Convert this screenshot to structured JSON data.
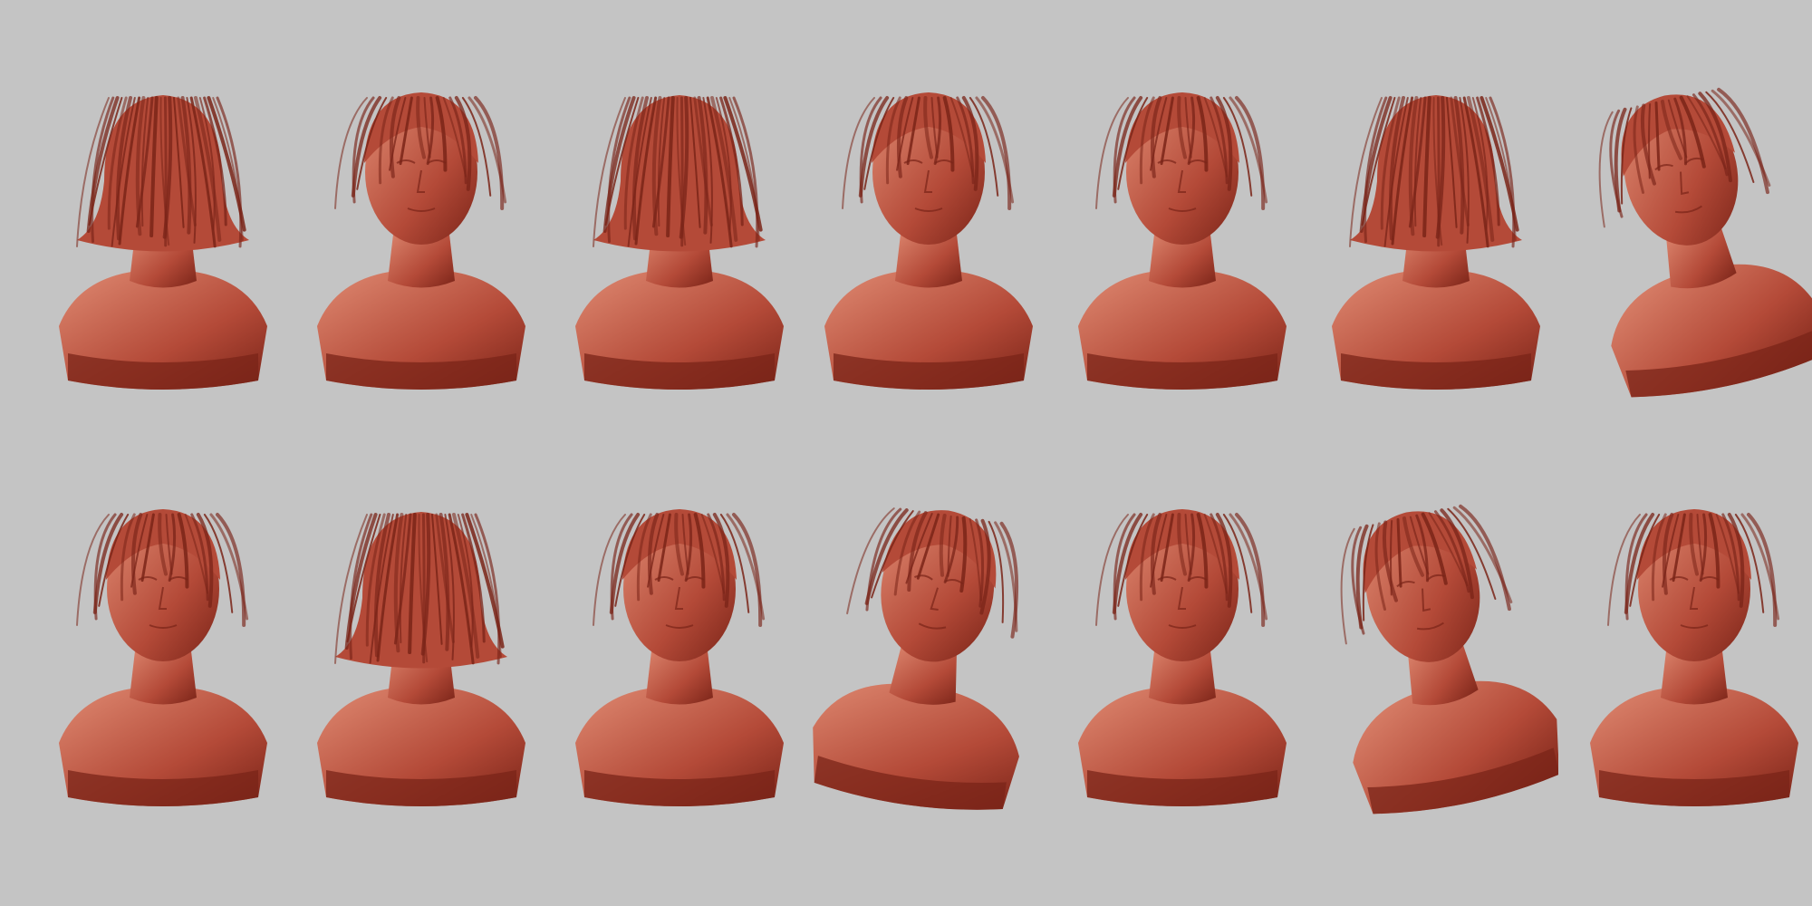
{
  "scene": {
    "description_colors": {
      "background": "#c4c4c4",
      "clay_base": "#b44a38",
      "clay_light": "#df8a72",
      "clay_shadow": "#7a2418"
    },
    "rows": [
      {
        "id": "top",
        "busts": [
          {
            "view": "back"
          },
          {
            "view": "three-quarter-right"
          },
          {
            "view": "profile-left-back"
          },
          {
            "view": "low-angle-front"
          },
          {
            "view": "front"
          },
          {
            "view": "profile-right-back"
          },
          {
            "view": "tilted-left"
          }
        ]
      },
      {
        "id": "bottom",
        "busts": [
          {
            "view": "profile-right"
          },
          {
            "view": "back-top"
          },
          {
            "view": "three-quarter-left"
          },
          {
            "view": "top-down-front"
          },
          {
            "view": "front"
          },
          {
            "view": "top-down-tilted"
          },
          {
            "view": "three-quarter-left-low"
          }
        ]
      }
    ]
  }
}
